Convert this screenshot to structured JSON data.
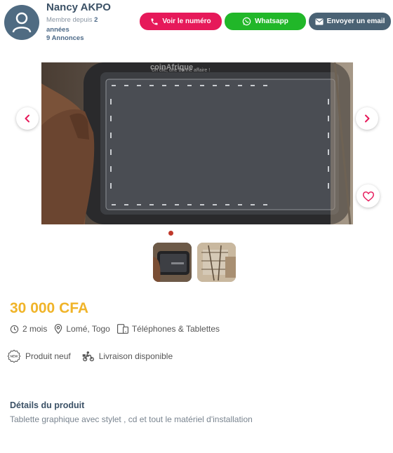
{
  "seller": {
    "name": "Nancy AKPO",
    "member_since_label": "Membre depuis",
    "member_since_value": "2 années",
    "ads_count": "9 Annonces"
  },
  "actions": {
    "phone_label": "Voir le numéro",
    "whatsapp_label": "Whatsapp",
    "email_label": "Envoyer un email"
  },
  "gallery": {
    "watermark_title": "coinAfrique",
    "watermark_tagline": "Un clic, une bonne affaire !",
    "thumbnail_count": 2,
    "active_index": 0
  },
  "listing": {
    "price": "30 000 CFA",
    "posted": "2 mois",
    "location": "Lomé, Togo",
    "category": "Téléphones & Tablettes",
    "condition": "Produit neuf",
    "condition_badge": "NEW",
    "delivery": "Livraison disponible"
  },
  "details": {
    "title": "Détails du produit",
    "description": "Tablette graphique avec stylet , cd  et tout le matériel d'installation"
  },
  "colors": {
    "phone_button": "#e6195a",
    "whatsapp_button": "#21b729",
    "email_button": "#4a6274",
    "price": "#f0b429",
    "active_dot": "#c0392b"
  },
  "icons": {
    "avatar": "user-icon",
    "phone": "phone-icon",
    "whatsapp": "whatsapp-icon",
    "email": "mail-icon",
    "prev": "chevron-left-icon",
    "next": "chevron-right-icon",
    "favorite": "heart-icon",
    "time": "clock-icon",
    "location": "pin-icon",
    "category": "devices-icon",
    "condition": "new-badge-icon",
    "delivery": "delivery-icon"
  }
}
